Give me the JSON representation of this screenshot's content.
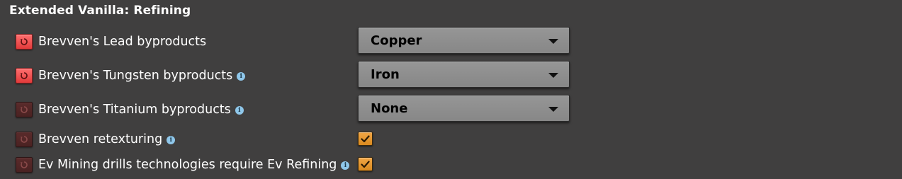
{
  "section": {
    "title": "Extended Vanilla: Refining"
  },
  "settings": [
    {
      "label": "Brevven's Lead byproducts",
      "reset_state": "active",
      "has_info": false,
      "control": "dropdown",
      "value": "Copper"
    },
    {
      "label": "Brevven's Tungsten byproducts",
      "reset_state": "active",
      "has_info": true,
      "control": "dropdown",
      "value": "Iron"
    },
    {
      "label": "Brevven's Titanium byproducts",
      "reset_state": "disabled",
      "has_info": true,
      "control": "dropdown",
      "value": "None"
    },
    {
      "label": "Brevven retexturing",
      "reset_state": "disabled",
      "has_info": true,
      "control": "checkbox",
      "checked": true
    },
    {
      "label": "Ev Mining drills technologies require Ev Refining",
      "reset_state": "disabled",
      "has_info": true,
      "control": "checkbox",
      "checked": true
    }
  ],
  "icons": {
    "reset": "reset-icon",
    "info": "info-icon",
    "dropdown_arrow": "chevron-down-icon",
    "check": "checkmark-icon"
  },
  "colors": {
    "background": "#403f3f",
    "reset_active": "#f04f4f",
    "reset_disabled": "#512626",
    "dropdown": "#8e8e8e",
    "checkbox": "#e6962e",
    "info": "#8fc7ea"
  }
}
